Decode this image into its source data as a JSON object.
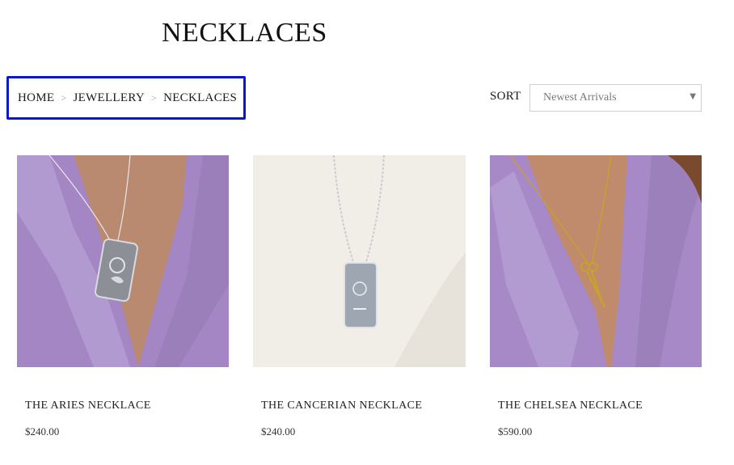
{
  "page": {
    "title": "NECKLACES"
  },
  "breadcrumb": {
    "items": [
      "HOME",
      "JEWELLERY",
      "NECKLACES"
    ],
    "separator": ">"
  },
  "sort": {
    "label": "SORT",
    "selected": "Newest Arrivals"
  },
  "products": [
    {
      "name": "THE ARIES NECKLACE",
      "price": "$240.00"
    },
    {
      "name": "THE CANCERIAN NECKLACE",
      "price": "$240.00"
    },
    {
      "name": "THE CHELSEA NECKLACE",
      "price": "$590.00"
    }
  ],
  "colors": {
    "highlight": "#0a18c8",
    "shirt": "#a58bc7",
    "skin": "#c88a6e",
    "backdrop": "#f1eee8"
  }
}
